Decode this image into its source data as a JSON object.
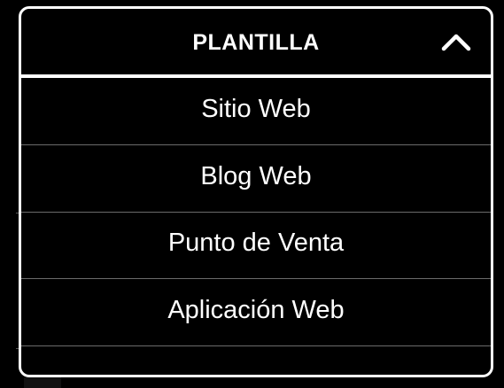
{
  "dropdown": {
    "title": "PLANTILLA",
    "toggle_icon": "chevron-up-icon",
    "options": [
      {
        "label": "Sitio Web"
      },
      {
        "label": "Blog Web"
      },
      {
        "label": "Punto de Venta"
      },
      {
        "label": "Aplicación Web"
      }
    ]
  },
  "colors": {
    "background": "#000000",
    "foreground": "#ffffff",
    "divider": "#6b6b6b"
  }
}
